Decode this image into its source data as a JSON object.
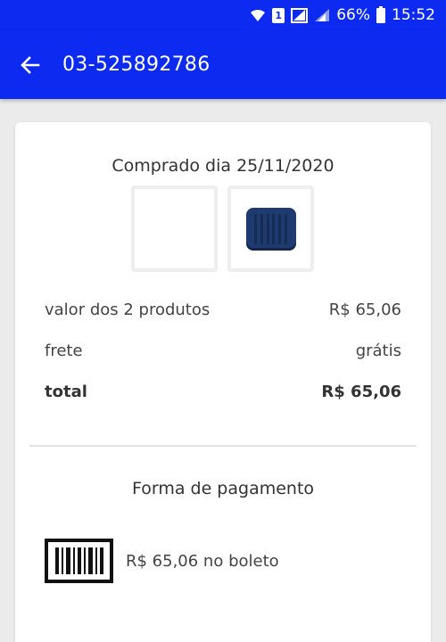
{
  "status_bar": {
    "battery": "66%",
    "time": "15:52",
    "sim_label": "1"
  },
  "app_bar": {
    "title": "03-525892786",
    "background_color": "#0d2bf0"
  },
  "order": {
    "purchase_date": "Comprado dia 25/11/2020",
    "summary": {
      "products_label": "valor dos 2 produtos",
      "products_value": "R$ 65,06",
      "shipping_label": "frete",
      "shipping_value": "grátis",
      "total_label": "total",
      "total_value": "R$ 65,06"
    }
  },
  "payment": {
    "title": "Forma de pagamento",
    "method_text": "R$ 65,06 no boleto",
    "icon": "barcode-icon"
  }
}
